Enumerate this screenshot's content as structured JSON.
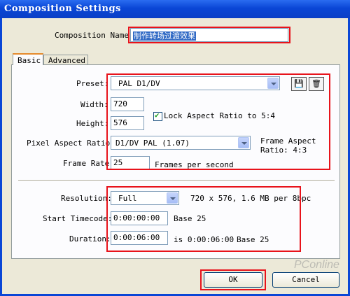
{
  "window": {
    "title": "Composition Settings"
  },
  "composition_name": {
    "label": "Composition Name:",
    "value": "制作转场过渡效果"
  },
  "tabs": [
    {
      "label": "Basic"
    },
    {
      "label": "Advanced"
    }
  ],
  "basic": {
    "preset": {
      "label": "Preset:",
      "value": "PAL D1/DV",
      "save_icon": "💾",
      "delete_icon": "🗑"
    },
    "width": {
      "label": "Width:",
      "value": "720"
    },
    "height": {
      "label": "Height:",
      "value": "576"
    },
    "lock_aspect": {
      "label": "Lock Aspect Ratio to 5:4",
      "checked": true
    },
    "pixel_aspect": {
      "label": "Pixel Aspect Ratio:",
      "value": "D1/DV PAL (1.07)",
      "frame_aspect": "Frame Aspect Ratio: 4:3"
    },
    "frame_rate": {
      "label": "Frame Rate:",
      "value": "25",
      "unit": "Frames per second"
    },
    "resolution": {
      "label": "Resolution:",
      "value": "Full",
      "info": "720 x 576, 1.6 MB per 8bpc"
    },
    "start_timecode": {
      "label": "Start Timecode:",
      "value": "0:00:00:00",
      "base": "Base 25"
    },
    "duration": {
      "label": "Duration:",
      "value": "0:00:06:00",
      "info": "is 0:00:06:00",
      "base": "Base 25"
    }
  },
  "buttons": {
    "ok": "OK",
    "cancel": "Cancel"
  },
  "watermark": "PConline"
}
